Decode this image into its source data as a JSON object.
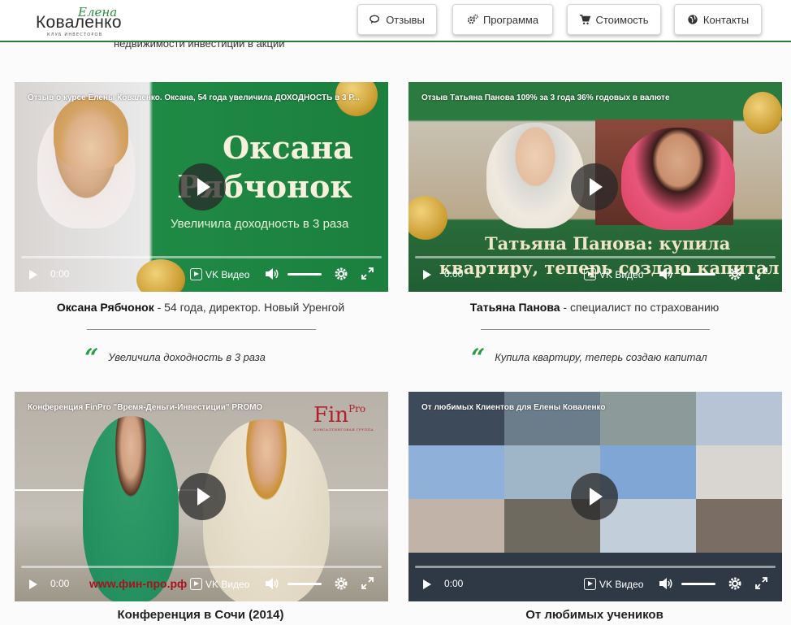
{
  "header": {
    "logo_script": "Елена",
    "logo_main": "Коваленко",
    "logo_sub": "КЛУБ ИНВЕСТОРОВ",
    "nav": [
      {
        "label": "Отзывы",
        "icon": "comments-icon"
      },
      {
        "label": "Программа",
        "icon": "gears-icon"
      },
      {
        "label": "Стоимость",
        "icon": "cart-icon"
      },
      {
        "label": "Контакты",
        "icon": "globe-icon"
      }
    ]
  },
  "cut_text": "недвижимости инвестиции в акции",
  "player": {
    "time": "0:00",
    "vk_label": "VK Видео"
  },
  "videos": [
    {
      "title": "Отзыв о курсе Елены Коваленко. Оксана, 54 года увеличила ДОХОДНОСТЬ в 3 Р...",
      "overlay_line1": "Оксана",
      "overlay_line2": "Рябчонок",
      "overlay_sub": "Увеличила доходность в 3 раза",
      "name": "Оксана Рябчонок",
      "desc": " - 54 года, директор. Новый Уренгой",
      "quote": "Увеличила доходность в 3 раза"
    },
    {
      "title": "Отзыв Татьяна Панова 109% за 3 года 36% годовых в валюте",
      "overlay_line1": "Татьяна Панова: купила",
      "overlay_line2": "квартиру, теперь создаю капитал",
      "name": "Татьяна Панова",
      "desc": " - специалист по страхованию",
      "quote": "Купила квартиру, теперь создаю капитал"
    },
    {
      "title": "Конференция FinPro \"Время-Деньги-Инвестиции\" PROMO",
      "brand": "Fin",
      "brand_sup": "Pro",
      "brand_sub": "КОНСАЛТИНГОВАЯ ГРУППА",
      "site": "www.фин-про.рф",
      "caption": "Конференция в Сочи (2014)"
    },
    {
      "title": "От любимых Клиентов для Елены Коваленко",
      "caption": "От любимых учеников"
    }
  ],
  "quote_mark": "“"
}
